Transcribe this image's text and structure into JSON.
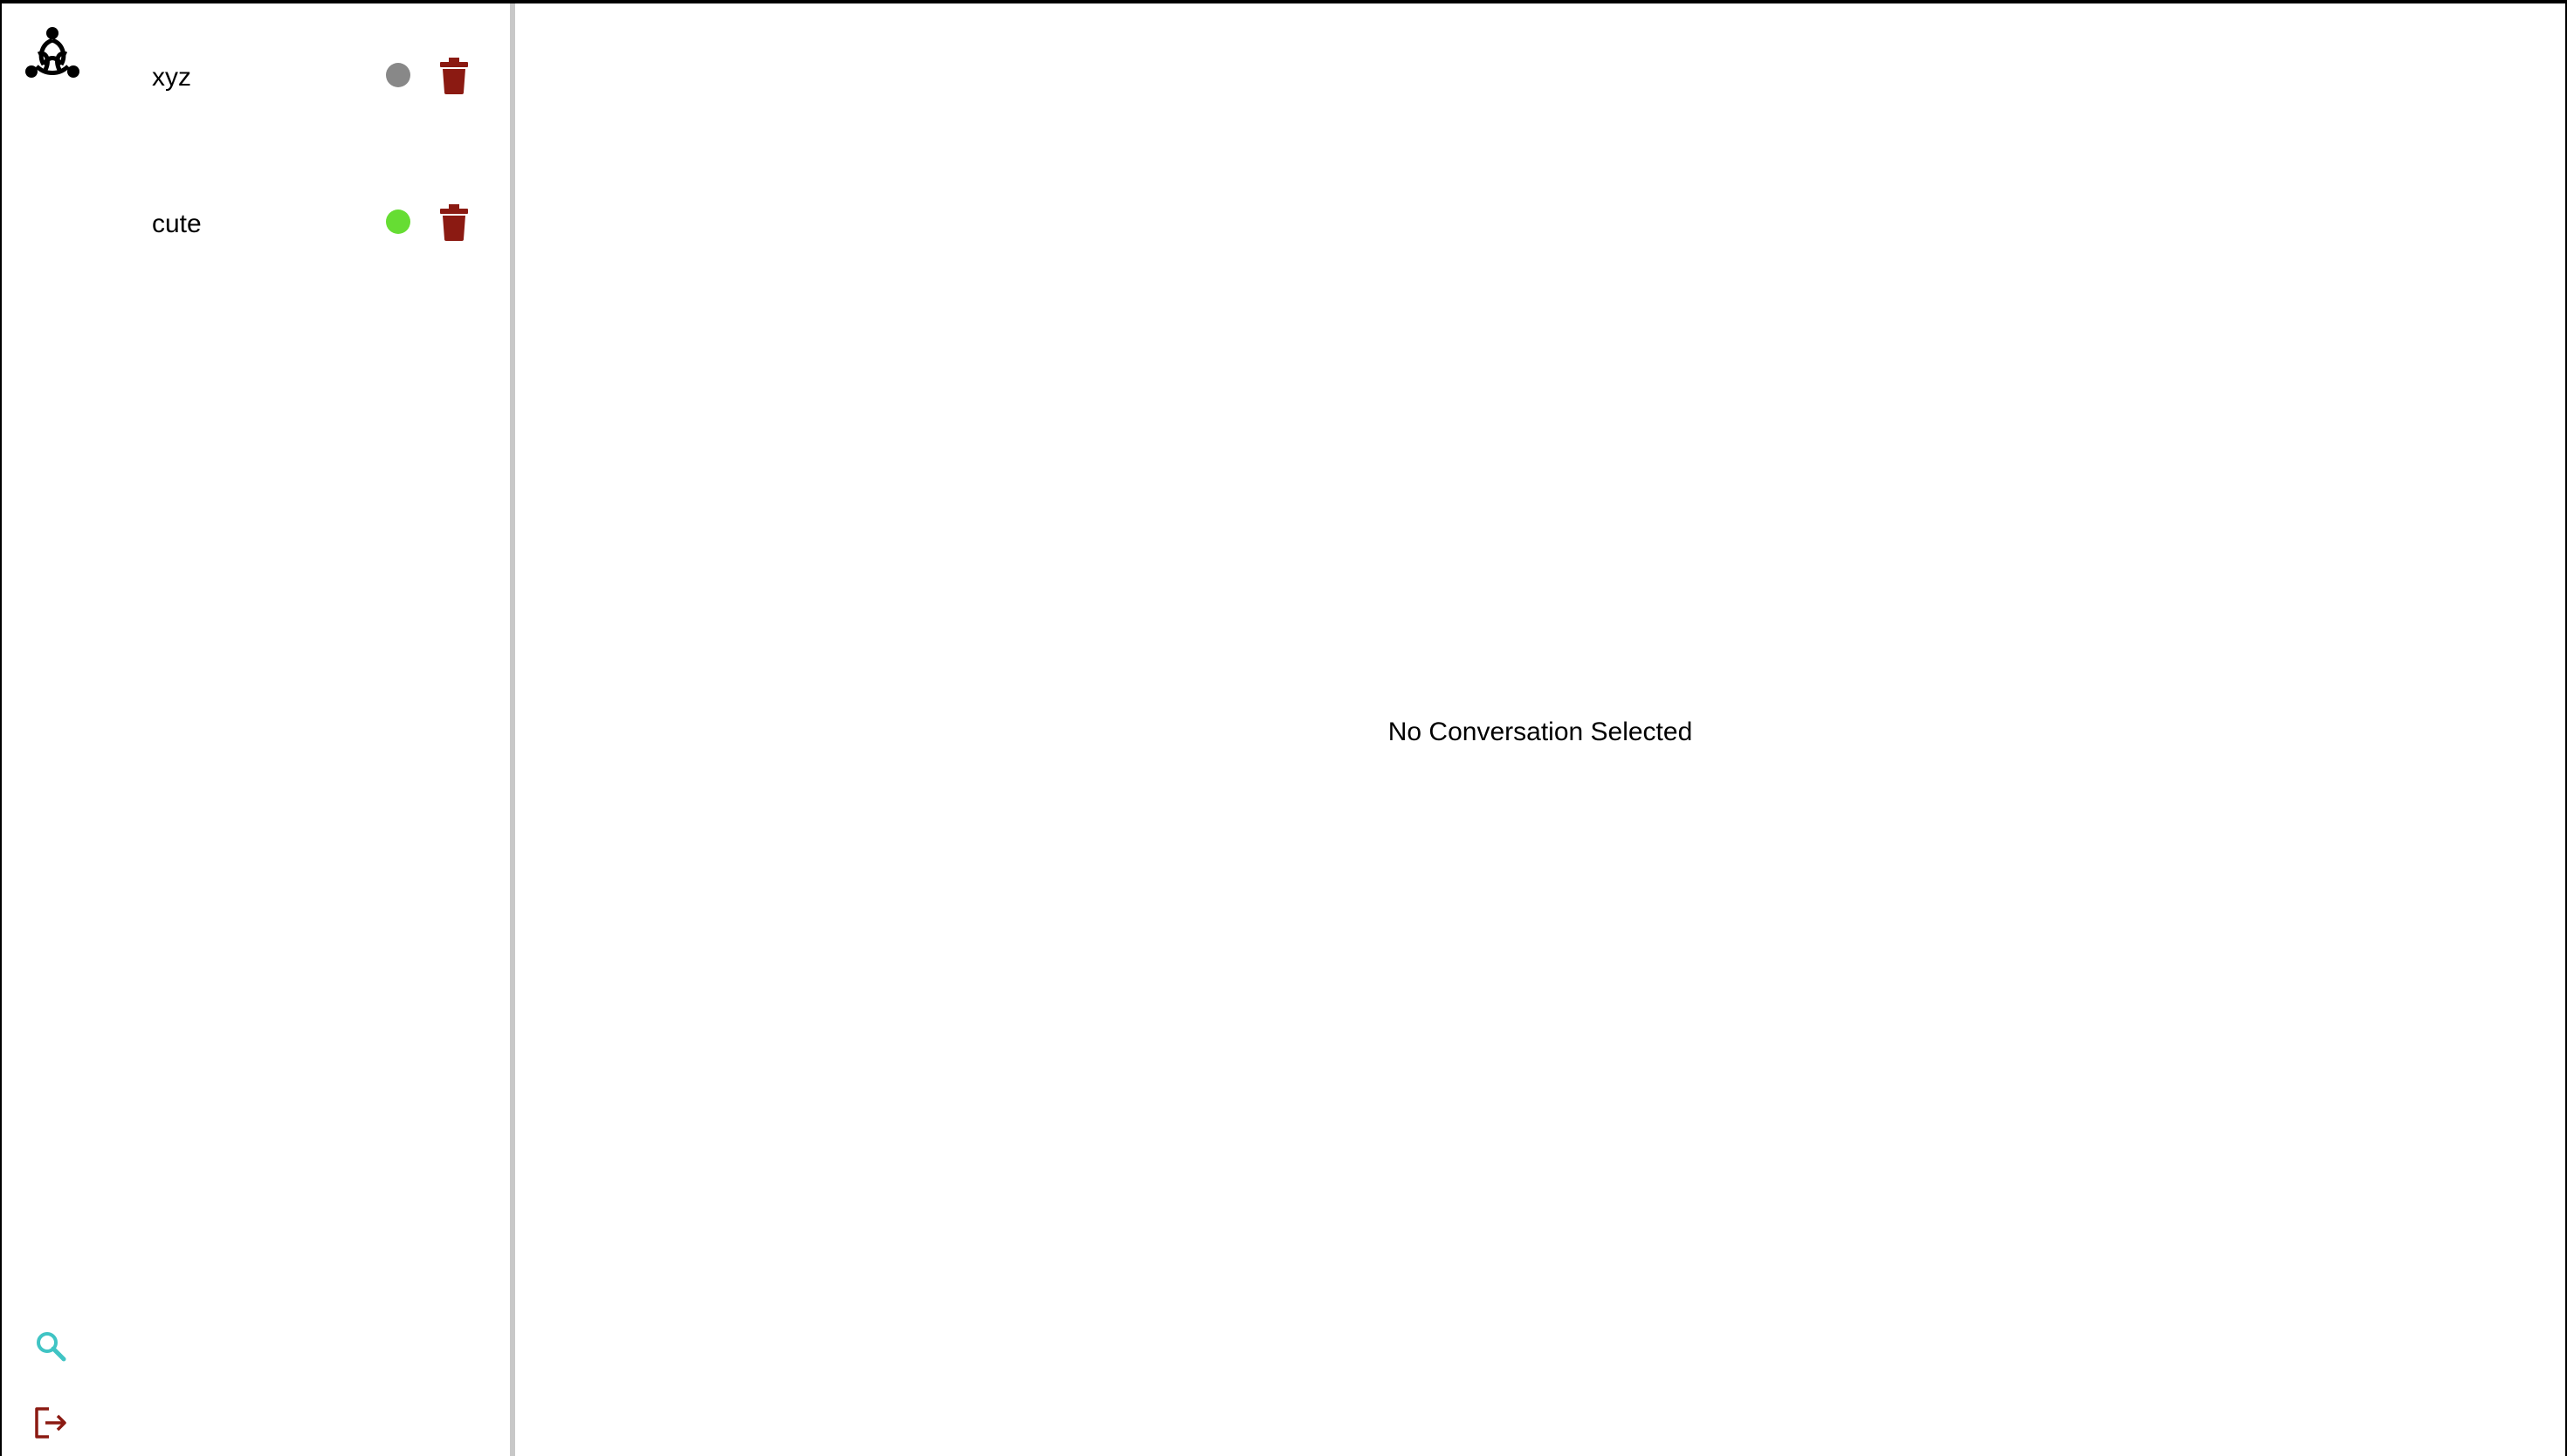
{
  "app": {
    "logo_icon": "threads-logo-icon"
  },
  "rail": {
    "search_icon": "search-icon",
    "search_color": "#40c4c4",
    "logout_icon": "logout-icon",
    "logout_color": "#8b1a12"
  },
  "conversations": [
    {
      "name": "xyz",
      "status": "offline",
      "status_color": "#888888",
      "delete_icon": "trash-icon"
    },
    {
      "name": "cute",
      "status": "online",
      "status_color": "#66dd33",
      "delete_icon": "trash-icon"
    }
  ],
  "colors": {
    "delete": "#8b1a12",
    "divider": "#c8c8c8"
  },
  "main": {
    "empty_message": "No Conversation Selected"
  }
}
